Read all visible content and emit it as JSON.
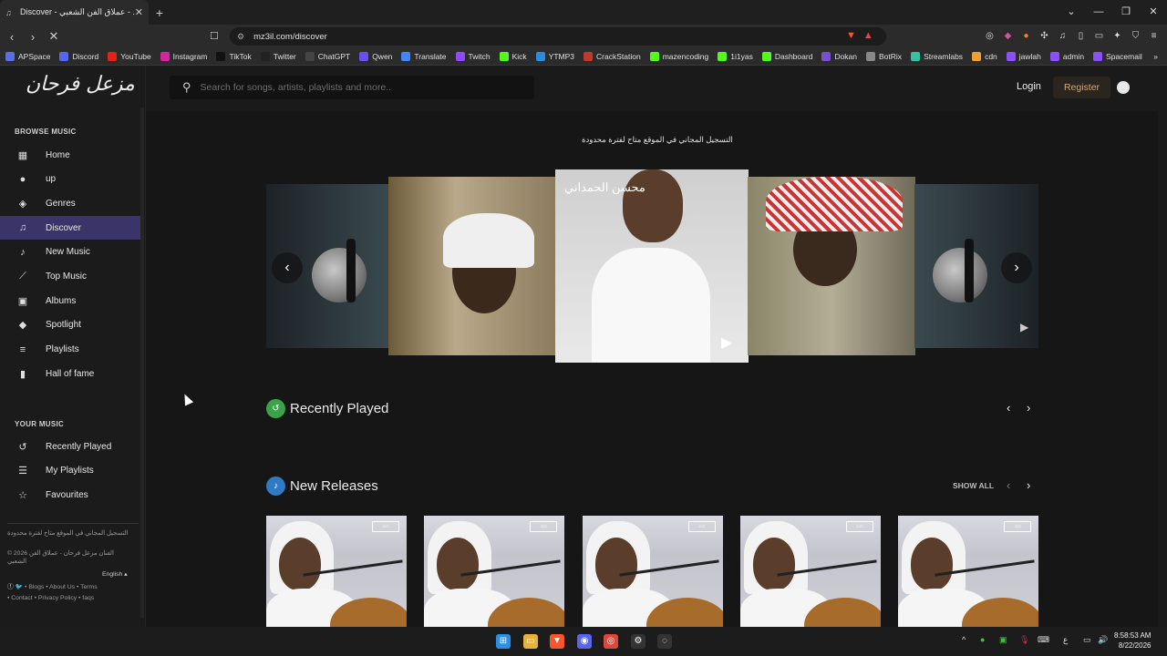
{
  "browser": {
    "tab_title": "Discover - عملاق الفن الشعبي - ...",
    "url": "mz3il.com/discover",
    "bookmarks": [
      {
        "label": "APSpace",
        "icon": "apspace-icon",
        "color": "#5b6ee1"
      },
      {
        "label": "Discord",
        "icon": "discord-icon",
        "color": "#5865f2"
      },
      {
        "label": "YouTube",
        "icon": "youtube-icon",
        "color": "#e62117"
      },
      {
        "label": "Instagram",
        "icon": "instagram-icon",
        "color": "#d6249f"
      },
      {
        "label": "TikTok",
        "icon": "tiktok-icon",
        "color": "#111111"
      },
      {
        "label": "Twitter",
        "icon": "twitter-icon",
        "color": "#222222"
      },
      {
        "label": "ChatGPT",
        "icon": "chatgpt-icon",
        "color": "#444444"
      },
      {
        "label": "Qwen",
        "icon": "qwen-icon",
        "color": "#6a4ff0"
      },
      {
        "label": "Translate",
        "icon": "translate-icon",
        "color": "#4285f4"
      },
      {
        "label": "Twitch",
        "icon": "twitch-icon",
        "color": "#9146ff"
      },
      {
        "label": "Kick",
        "icon": "kick-icon",
        "color": "#53fc18"
      },
      {
        "label": "YTMP3",
        "icon": "ytmp3-icon",
        "color": "#2e8bdb"
      },
      {
        "label": "CrackStation",
        "icon": "crackstation-icon",
        "color": "#c0392b"
      },
      {
        "label": "mazencoding",
        "icon": "kick-icon",
        "color": "#53fc18"
      },
      {
        "label": "1i1yas",
        "icon": "kick-icon",
        "color": "#53fc18"
      },
      {
        "label": "Dashboard",
        "icon": "kick-icon",
        "color": "#53fc18"
      },
      {
        "label": "Dokan",
        "icon": "dokan-icon",
        "color": "#7a4fcf"
      },
      {
        "label": "BotRix",
        "icon": "botrix-icon",
        "color": "#888888"
      },
      {
        "label": "Streamlabs",
        "icon": "streamlabs-icon",
        "color": "#31c3a2"
      },
      {
        "label": "cdn",
        "icon": "cdn-icon",
        "color": "#f0a030"
      },
      {
        "label": "jawlah",
        "icon": "jawlah-icon",
        "color": "#8a4fff"
      },
      {
        "label": "admin",
        "icon": "admin-icon",
        "color": "#8a4fff"
      },
      {
        "label": "Spacemail",
        "icon": "spacemail-icon",
        "color": "#8a4fff"
      }
    ]
  },
  "site": {
    "logo": "مزعل فرحان",
    "search_placeholder": "Search for songs, artists, playlists and more..",
    "login": "Login",
    "register": "Register"
  },
  "sidebar": {
    "browse_title": "BROWSE MUSIC",
    "browse_items": [
      {
        "label": "Home",
        "icon": "grid-icon"
      },
      {
        "label": "up",
        "icon": "circle-icon"
      },
      {
        "label": "Genres",
        "icon": "layers-icon"
      },
      {
        "label": "Discover",
        "icon": "music-note-icon"
      },
      {
        "label": "New Music",
        "icon": "note-icon"
      },
      {
        "label": "Top Music",
        "icon": "trend-icon"
      },
      {
        "label": "Albums",
        "icon": "album-icon"
      },
      {
        "label": "Spotlight",
        "icon": "drop-icon"
      },
      {
        "label": "Playlists",
        "icon": "list-icon"
      },
      {
        "label": "Hall of fame",
        "icon": "bars-icon"
      }
    ],
    "your_title": "YOUR MUSIC",
    "your_items": [
      {
        "label": "Recently Played",
        "icon": "history-icon"
      },
      {
        "label": "My Playlists",
        "icon": "playlist-icon"
      },
      {
        "label": "Favourites",
        "icon": "star-icon"
      }
    ],
    "footer_notice": "التسجيل المجاني في الموقع متاح لفترة محدودة",
    "copyright": "© 2026 الفنان مزعل فرحان - عملاق الفن الشعبي",
    "language": "English",
    "links": "• Blogs • About Us • Terms",
    "links2": "• Contact • Privacy Policy • faqs"
  },
  "main": {
    "banner": "التسجيل المجاني في الموقع متاح لفترة محدودة",
    "featured_name": "محسن الحمداني",
    "recently_played": "Recently Played",
    "new_releases": "New Releases",
    "show_all": "SHOW ALL"
  },
  "taskbar": {
    "time": "8:58:53 AM",
    "date": "8/22/2026",
    "lang": "ع"
  }
}
